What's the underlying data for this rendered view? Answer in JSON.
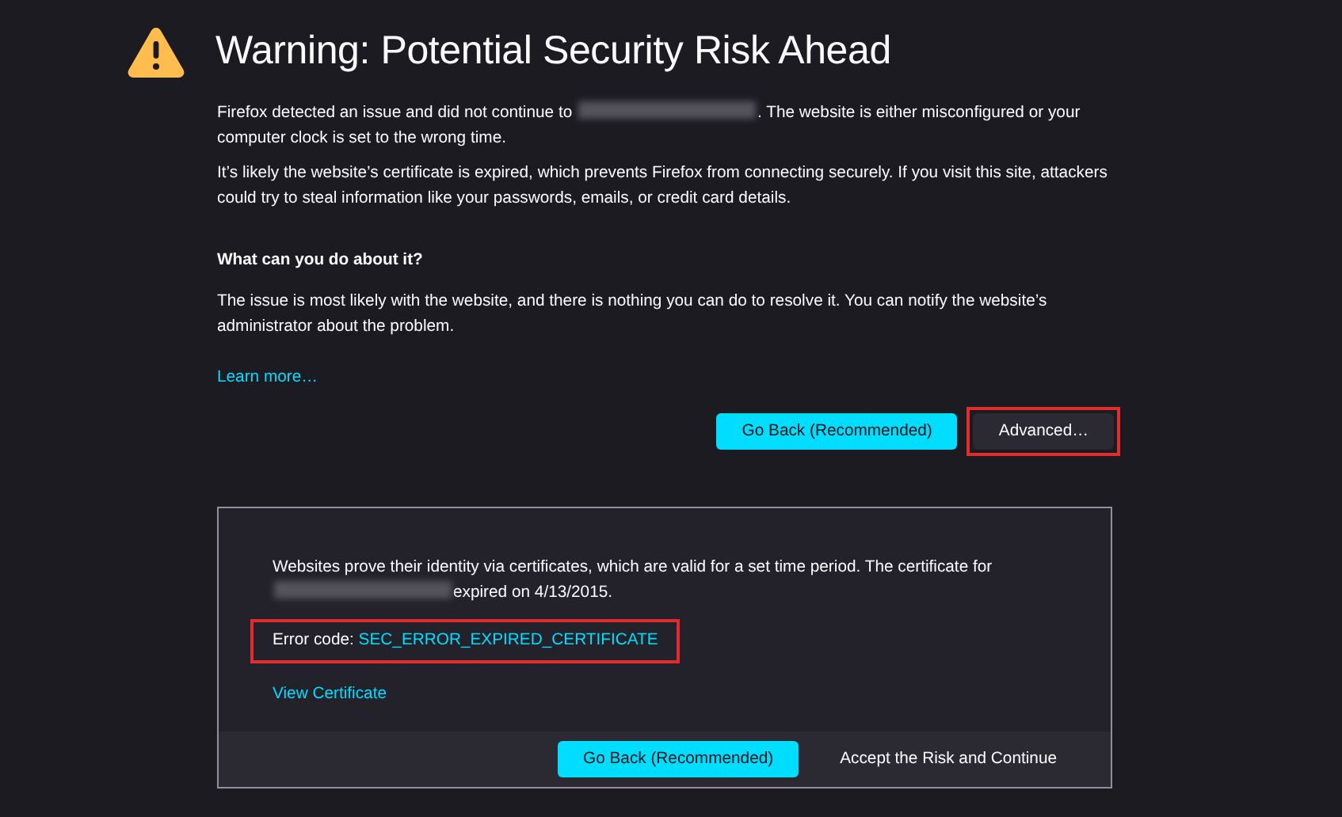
{
  "title": "Warning: Potential Security Risk Ahead",
  "paragraphs": [
    {
      "parts": [
        {
          "kind": "text",
          "text": "Firefox detected an issue and did not continue to "
        },
        {
          "kind": "redacted"
        },
        {
          "kind": "text",
          "text": ". The website is either misconfigured or your computer clock is set to the wrong time."
        }
      ]
    },
    {
      "parts": [
        {
          "kind": "text",
          "text": "It’s likely the website’s certificate is expired, which prevents Firefox from connecting securely. If you visit this site, attackers could try to steal information like your passwords, emails, or credit card details."
        }
      ]
    }
  ],
  "heading": "What can you do about it?",
  "advice": "The issue is most likely with the website, and there is nothing you can do to resolve it. You can notify the website’s administrator about the problem.",
  "learn_more": "Learn more…",
  "buttons": [
    {
      "label": "Go Back (Recommended)",
      "kind": "primary",
      "highlighted": false
    },
    {
      "label": "Advanced…",
      "kind": "secondary",
      "highlighted": true
    }
  ],
  "advanced": {
    "parts": [
      {
        "kind": "text",
        "text": "Websites prove their identity via certificates, which are valid for a set time period. The certificate for "
      },
      {
        "kind": "redacted"
      },
      {
        "kind": "text",
        "text": "expired on 4/13/2015."
      }
    ],
    "error_code": {
      "label": "Error code:",
      "code": "SEC_ERROR_EXPIRED_CERTIFICATE",
      "highlighted": true
    },
    "link": "View Certificate",
    "buttons": [
      {
        "label": "Go Back (Recommended)",
        "kind": "primary",
        "highlighted": false
      },
      {
        "label": "Accept the Risk and Continue",
        "kind": "secondary",
        "highlighted": false
      }
    ]
  }
}
